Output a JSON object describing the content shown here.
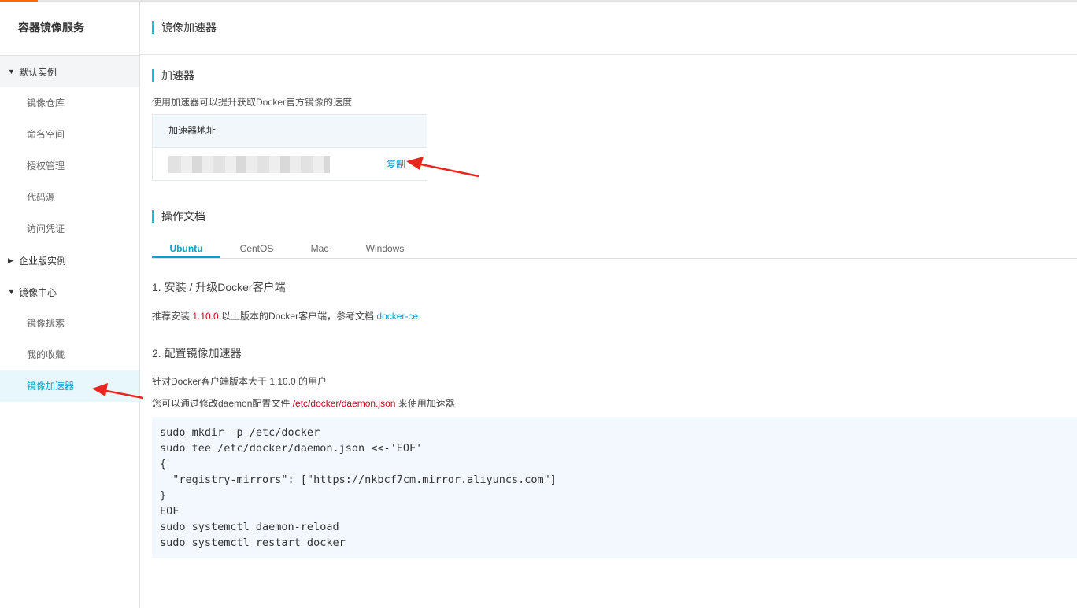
{
  "sidebar": {
    "title": "容器镜像服务",
    "groups": [
      {
        "label": "默认实例",
        "expanded": true,
        "items": [
          "镜像仓库",
          "命名空间",
          "授权管理",
          "代码源",
          "访问凭证"
        ]
      },
      {
        "label": "企业版实例",
        "expanded": false,
        "items": []
      },
      {
        "label": "镜像中心",
        "expanded": true,
        "items": [
          "镜像搜索",
          "我的收藏",
          "镜像加速器"
        ]
      }
    ],
    "active_item": "镜像加速器"
  },
  "page": {
    "title": "镜像加速器"
  },
  "accelerator": {
    "section_title": "加速器",
    "description": "使用加速器可以提升获取Docker官方镜像的速度",
    "box_header": "加速器地址",
    "copy_label": "复制"
  },
  "docs": {
    "section_title": "操作文档",
    "tabs": [
      "Ubuntu",
      "CentOS",
      "Mac",
      "Windows"
    ],
    "active_tab": "Ubuntu",
    "step1": {
      "title": "1. 安装 / 升级Docker客户端",
      "text_before": "推荐安装 ",
      "version": "1.10.0",
      "text_after": " 以上版本的Docker客户端，参考文档 ",
      "link": "docker-ce"
    },
    "step2": {
      "title": "2. 配置镜像加速器",
      "line1": "针对Docker客户端版本大于 1.10.0 的用户",
      "line2_before": "您可以通过修改daemon配置文件 ",
      "line2_path": "/etc/docker/daemon.json",
      "line2_after": " 来使用加速器"
    },
    "code": "sudo mkdir -p /etc/docker\nsudo tee /etc/docker/daemon.json <<-'EOF'\n{\n  \"registry-mirrors\": [\"https://nkbcf7cm.mirror.aliyuncs.com\"]\n}\nEOF\nsudo systemctl daemon-reload\nsudo systemctl restart docker"
  },
  "colors": {
    "accent": "#00a2ca",
    "section_bar": "#00c1de",
    "highlight_red": "#d0021b",
    "arrow_red": "#e8281e"
  }
}
